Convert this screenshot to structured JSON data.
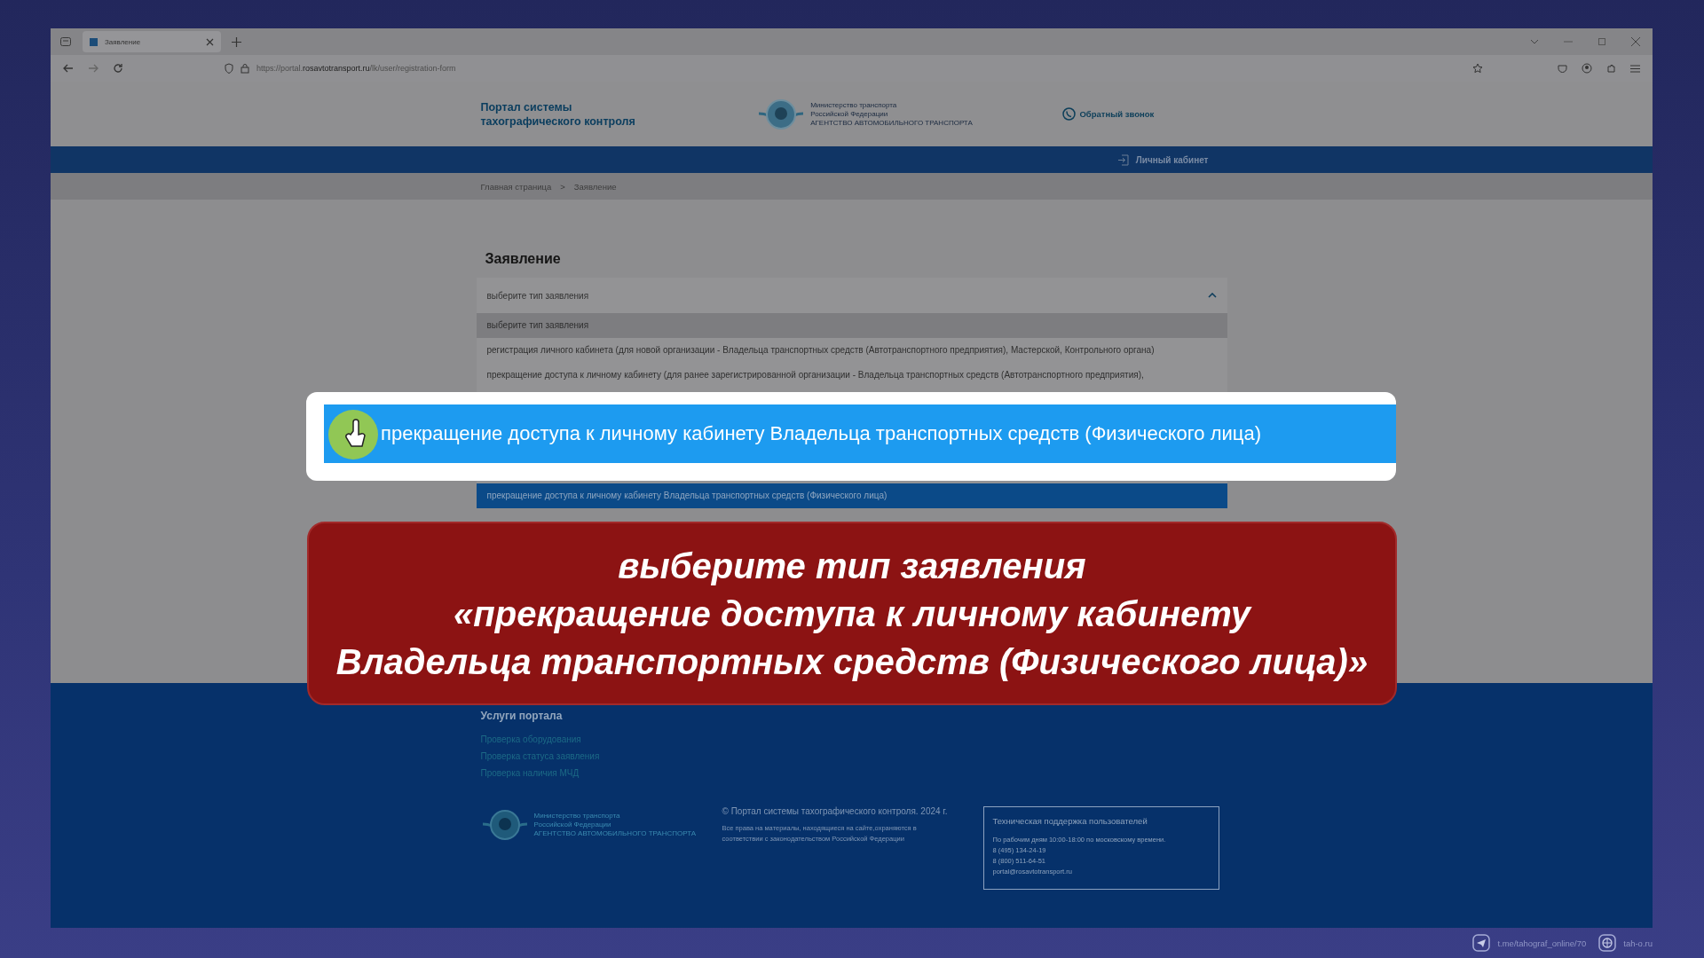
{
  "browser": {
    "tab_title": "Заявление",
    "url_prefix": "https://portal.",
    "url_domain": "rosavtotransport.ru",
    "url_path": "/lk/user/registration-form"
  },
  "header": {
    "title_lines": [
      "Портал системы",
      "тахографического контроля"
    ],
    "logo_lines": [
      "Министерство транспорта",
      "Российской Федерации",
      "АГЕНТСТВО АВТОМОБИЛЬНОГО ТРАНСПОРТА"
    ],
    "callback": "Обратный звонок"
  },
  "nav": {
    "account": "Личный кабинет"
  },
  "breadcrumbs": {
    "items": [
      "Главная страница",
      "Заявление"
    ],
    "separator": ">"
  },
  "form": {
    "heading": "Заявление",
    "select": {
      "value": "выберите тип заявления",
      "expanded": true
    },
    "options": [
      {
        "label": "выберите тип заявления",
        "hovered": true,
        "selected": false
      },
      {
        "label": "регистрация личного кабинета (для новой организации - Владельца транспортных средств (Автотранспортного предприятия), Мастерской, Контрольного органа)",
        "hovered": false,
        "selected": false
      },
      {
        "label": "прекращение доступа к личному кабинету (для ранее зарегистрированной организации - Владельца транспортных средств (Автотранспортного предприятия),",
        "hovered": false,
        "selected": false
      },
      {
        "label": "прекращение доступа к личному кабинету Владельца транспортных средств (Физического лица)",
        "hovered": false,
        "selected": true
      }
    ]
  },
  "callout": {
    "text": "прекращение доступа к личному кабинету Владельца транспортных средств (Физического лица)"
  },
  "caption": {
    "lines": [
      "выберите тип заявления",
      "«прекращение доступа к личному кабинету",
      "Владельца транспортных средств (Физического лица)»"
    ]
  },
  "footer": {
    "services_title": "Услуги портала",
    "links": [
      "Проверка оборудования",
      "Проверка статуса заявления",
      "Проверка наличия МЧД"
    ],
    "logo_lines": [
      "Министерство транспорта",
      "Российской Федерации",
      "АГЕНТСТВО АВТОМОБИЛЬНОГО ТРАНСПОРТА"
    ],
    "copyright": "© Портал системы тахографического контроля. 2024 г.",
    "rights": "Все права на материалы, находящиеся на сайте,охраняются в соответствии с законодательством Российской Федерации",
    "support": {
      "title": "Техническая поддержка пользователей",
      "lines": [
        "По рабочим дням 10:00-18:00 по московскому времени.",
        "8 (495) 134-24-19",
        "8 (800) 511-64-51",
        "portal@rosavtotransport.ru"
      ]
    }
  },
  "channel_links": [
    "t.me/tahograf_online/70",
    "tah-o.ru"
  ]
}
